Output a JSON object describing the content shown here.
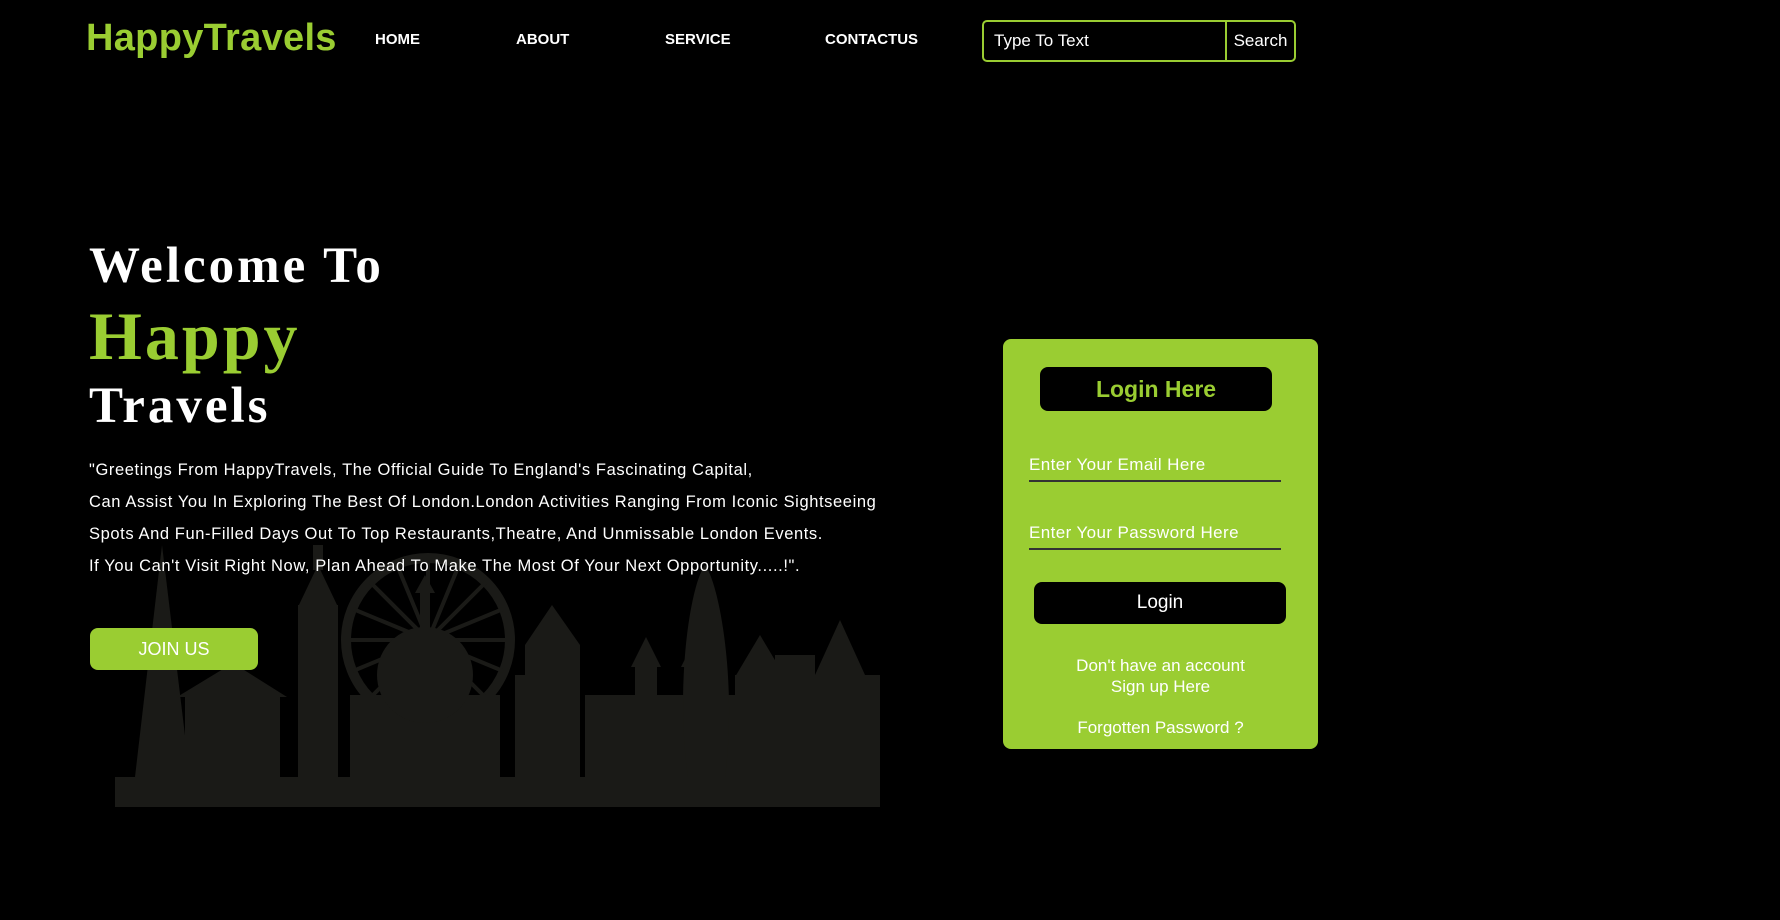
{
  "header": {
    "logo": "HappyTravels",
    "nav": [
      "HOME",
      "ABOUT",
      "SERVICE",
      "CONTACTUS"
    ],
    "search": {
      "placeholder": "Type To Text",
      "button_label": "Search"
    }
  },
  "hero": {
    "line1": "Welcome To",
    "line2": "Happy",
    "line3": "Travels",
    "paragraph": [
      "\"Greetings From HappyTravels, The Official Guide To England's Fascinating Capital,",
      "Can Assist You In Exploring The Best Of London.London Activities Ranging From Iconic Sightseeing",
      "Spots And Fun-Filled Days Out To Top Restaurants,Theatre, And Unmissable London Events.",
      "If You Can't Visit Right Now, Plan Ahead To Make The Most Of Your Next Opportunity.....!\"."
    ],
    "join_label": "JOIN US",
    "skyline_icon": "london-skyline-silhouette"
  },
  "login": {
    "title": "Login Here",
    "email_placeholder": "Enter Your Email Here",
    "password_placeholder": "Enter Your Password Here",
    "button_label": "Login",
    "signup_prompt": "Don't have an account",
    "signup_link": "Sign up Here",
    "forgot_link": "Forgotten Password ?"
  },
  "colors": {
    "background": "#000000",
    "accent": "#9acd32",
    "text": "#ffffff",
    "skyline": "#1a1a17"
  }
}
